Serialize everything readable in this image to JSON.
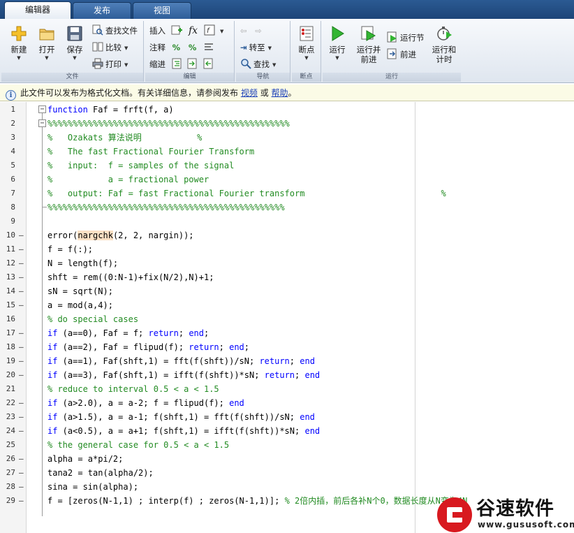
{
  "tabs": [
    {
      "label": "编辑器",
      "active": true
    },
    {
      "label": "发布",
      "active": false
    },
    {
      "label": "视图",
      "active": false
    }
  ],
  "ribbon": {
    "file": {
      "label": "文件",
      "new": "新建",
      "open": "打开",
      "save": "保存",
      "find_files": "查找文件",
      "compare": "比较",
      "print": "打印"
    },
    "edit": {
      "label": "编辑",
      "insert": "插入",
      "comment": "注释",
      "indent": "缩进",
      "fx": "fx"
    },
    "navigate": {
      "label": "导航",
      "goto": "转至",
      "find": "查找"
    },
    "breakpoints": {
      "label": "断点",
      "breakpoints": "断点"
    },
    "run": {
      "label": "运行",
      "run": "运行",
      "run_advance": "运行并\n前进",
      "run_section": "运行节",
      "advance": "前进",
      "run_time": "运行和\n计时"
    }
  },
  "infobar": {
    "text": "此文件可以发布为格式化文档。有关详细信息，请参阅发布",
    "link1": "视频",
    "or": "或",
    "link2": "帮助",
    "end": "。"
  },
  "code_lines": [
    {
      "n": "1",
      "bp": "",
      "html": "<span class=\"kw\">function</span> Faf = frft(f, a)"
    },
    {
      "n": "2",
      "bp": "",
      "html": "<span class=\"cm\">%%%%%%%%%%%%%%%%%%%%%%%%%%%%%%%%%%%%%%%%%%%%%%%%</span>"
    },
    {
      "n": "3",
      "bp": "",
      "html": "<span class=\"cm\">%   Ozakats 算法说明           %</span>"
    },
    {
      "n": "4",
      "bp": "",
      "html": "<span class=\"cm\">%   The fast Fractional Fourier Transform</span>"
    },
    {
      "n": "5",
      "bp": "",
      "html": "<span class=\"cm\">%   input:  f = samples of the signal</span>"
    },
    {
      "n": "6",
      "bp": "",
      "html": "<span class=\"cm\">%           a = fractional power</span>"
    },
    {
      "n": "7",
      "bp": "",
      "html": "<span class=\"cm\">%   output: Faf = fast Fractional Fourier transform                           %</span>"
    },
    {
      "n": "8",
      "bp": "",
      "html": "<span class=\"cm\">%%%%%%%%%%%%%%%%%%%%%%%%%%%%%%%%%%%%%%%%%%%%%%%</span>"
    },
    {
      "n": "9",
      "bp": "",
      "html": ""
    },
    {
      "n": "10",
      "bp": "–",
      "html": "error(<span class=\"hl\">nargchk</span>(2, 2, nargin));"
    },
    {
      "n": "11",
      "bp": "–",
      "html": "f = f(:);"
    },
    {
      "n": "12",
      "bp": "–",
      "html": "N = length(f);"
    },
    {
      "n": "13",
      "bp": "–",
      "html": "shft = rem((0:N-1)+fix(N/2),N)+1;"
    },
    {
      "n": "14",
      "bp": "–",
      "html": "sN = sqrt(N);"
    },
    {
      "n": "15",
      "bp": "–",
      "html": "a = mod(a,4);"
    },
    {
      "n": "16",
      "bp": "",
      "html": "<span class=\"cm\">% do special cases</span>"
    },
    {
      "n": "17",
      "bp": "–",
      "html": "<span class=\"kw\">if</span> (a==0), Faf = f; <span class=\"kw\">return</span>; <span class=\"kw\">end</span>;"
    },
    {
      "n": "18",
      "bp": "–",
      "html": "<span class=\"kw\">if</span> (a==2), Faf = flipud(f); <span class=\"kw\">return</span>; <span class=\"kw\">end</span>;"
    },
    {
      "n": "19",
      "bp": "–",
      "html": "<span class=\"kw\">if</span> (a==1), Faf(shft,1) = fft(f(shft))/sN; <span class=\"kw\">return</span>; <span class=\"kw\">end</span>"
    },
    {
      "n": "20",
      "bp": "–",
      "html": "<span class=\"kw\">if</span> (a==3), Faf(shft,1) = ifft(f(shft))*sN; <span class=\"kw\">return</span>; <span class=\"kw\">end</span>"
    },
    {
      "n": "21",
      "bp": "",
      "html": "<span class=\"cm\">% reduce to interval 0.5 &lt; a &lt; 1.5</span>"
    },
    {
      "n": "22",
      "bp": "–",
      "html": "<span class=\"kw\">if</span> (a&gt;2.0), a = a-2; f = flipud(f); <span class=\"kw\">end</span>"
    },
    {
      "n": "23",
      "bp": "–",
      "html": "<span class=\"kw\">if</span> (a&gt;1.5), a = a-1; f(shft,1) = fft(f(shft))/sN; <span class=\"kw\">end</span>"
    },
    {
      "n": "24",
      "bp": "–",
      "html": "<span class=\"kw\">if</span> (a&lt;0.5), a = a+1; f(shft,1) = ifft(f(shft))*sN; <span class=\"kw\">end</span>"
    },
    {
      "n": "25",
      "bp": "",
      "html": "<span class=\"cm\">% the general case for 0.5 &lt; a &lt; 1.5</span>"
    },
    {
      "n": "26",
      "bp": "–",
      "html": "alpha = a*pi/2;"
    },
    {
      "n": "27",
      "bp": "–",
      "html": "tana2 = tan(alpha/2);"
    },
    {
      "n": "28",
      "bp": "–",
      "html": "sina = sin(alpha);"
    },
    {
      "n": "29",
      "bp": "–",
      "html": "f = [zeros(N-1,1) ; interp(f) ; zeros(N-1,1)]; <span class=\"cm\">% 2倍内插，前后各补N个0，数据长度从N变为4N</span>"
    }
  ],
  "watermark": {
    "title": "谷速软件",
    "url": "www.gususoft.com"
  }
}
